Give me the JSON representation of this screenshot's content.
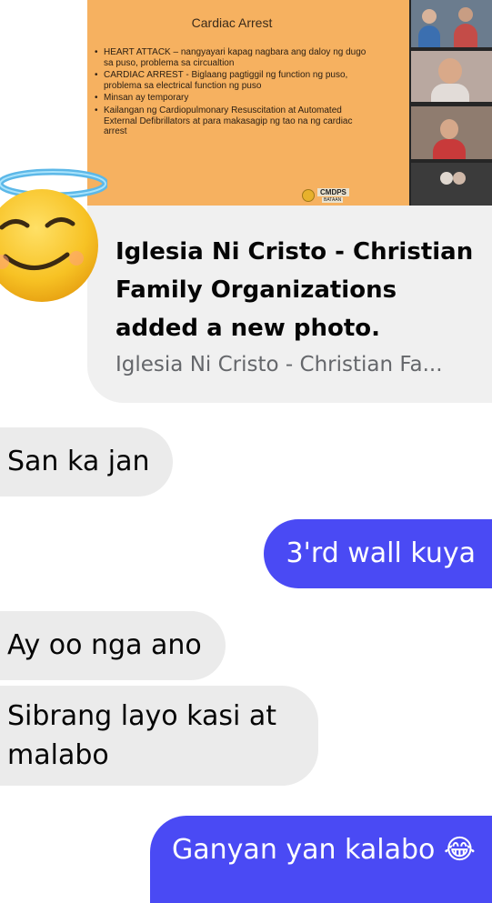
{
  "shared_photo": {
    "slide": {
      "title": "Cardiac Arrest",
      "bullets": [
        "HEART ATTACK – nangyayari kapag nagbara ang daloy ng dugo sa puso, problema sa circualtion",
        "CARDIAC ARREST - Biglaang pagtiggil ng function ng puso, problema sa electrical function ng puso",
        "Minsan ay temporary",
        "Kailangan ng Cardiopulmonary Resuscitation at Automated External Defibrillators at para makasagip ng tao na ng cardiac arrest"
      ],
      "logo_text": "CMDPS",
      "logo_subtext": "BATAAN"
    },
    "caption": {
      "title": "Iglesia Ni Cristo - Christian Family Organizations added a new photo.",
      "source": "Iglesia Ni Cristo - Christian Fa..."
    }
  },
  "reaction_icon": "smiling-face-with-halo-icon",
  "messages": [
    {
      "direction": "incoming",
      "text": "San ka jan"
    },
    {
      "direction": "outgoing",
      "text": "3'rd wall kuya"
    },
    {
      "direction": "incoming",
      "text": "Ay oo nga ano"
    },
    {
      "direction": "incoming",
      "text": "Sibrang layo kasi at malabo"
    },
    {
      "direction": "outgoing",
      "text": "Ganyan yan kalabo 😂"
    }
  ],
  "colors": {
    "outgoing_bubble": "#4a4af4",
    "incoming_bubble": "#ebebeb",
    "card_background": "#f0f0f0",
    "slide_background": "#f6b160"
  }
}
